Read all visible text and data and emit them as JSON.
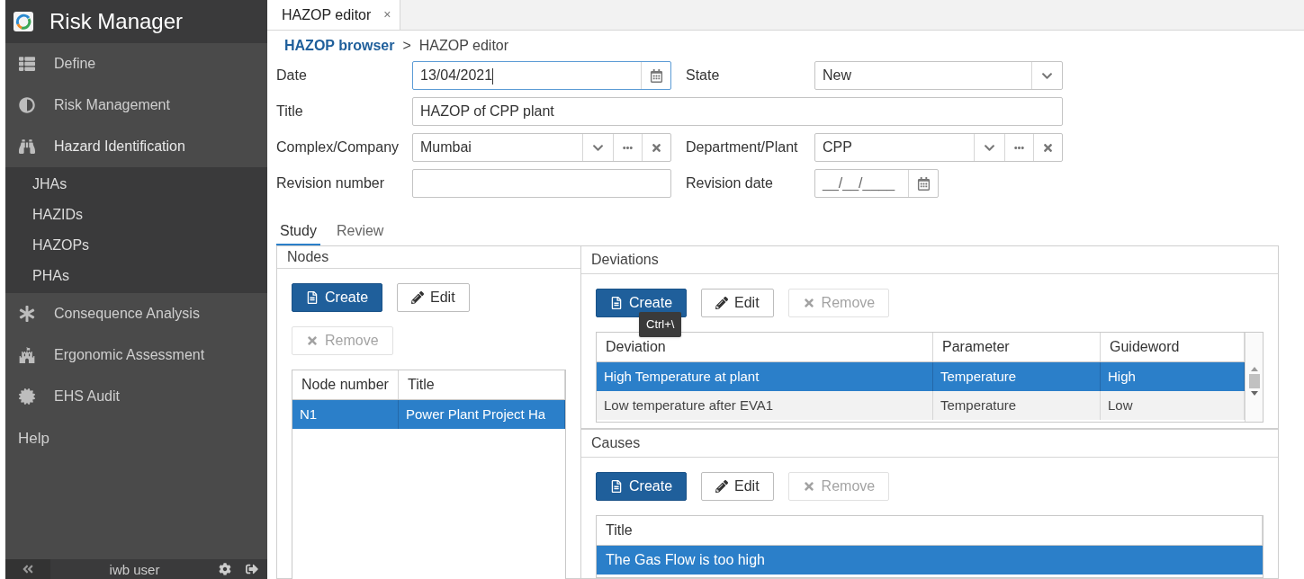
{
  "sidebar": {
    "title": "Risk Manager",
    "items": [
      {
        "label": "Define",
        "expanded": false
      },
      {
        "label": "Risk Management",
        "expanded": false
      },
      {
        "label": "Hazard Identification",
        "expanded": true,
        "children": [
          {
            "label": "JHAs"
          },
          {
            "label": "HAZIDs"
          },
          {
            "label": "HAZOPs"
          },
          {
            "label": "PHAs"
          }
        ]
      },
      {
        "label": "Consequence Analysis",
        "expanded": false
      },
      {
        "label": "Ergonomic Assessment",
        "expanded": false
      },
      {
        "label": "EHS Audit",
        "expanded": false
      }
    ],
    "help": "Help",
    "user": "iwb user"
  },
  "tab": {
    "label": "HAZOP editor",
    "close": "×"
  },
  "breadcrumb": {
    "link": "HAZOP browser",
    "separator": ">",
    "current": "HAZOP editor"
  },
  "form": [
    [
      {
        "label": "Date",
        "kind": "date",
        "value": "13/04/2021",
        "focused": true
      },
      {
        "label": "State",
        "kind": "select",
        "value": "New",
        "focused": false
      }
    ],
    [
      {
        "label": "Title",
        "kind": "text",
        "value": "HAZOP of CPP plant",
        "focused": false
      }
    ],
    [
      {
        "label": "Complex/Company",
        "kind": "lookup",
        "value": "Mumbai",
        "focused": false
      },
      {
        "label": "Department/Plant",
        "kind": "lookup",
        "value": "CPP",
        "focused": false
      }
    ],
    [
      {
        "label": "Revision number",
        "kind": "text",
        "focused": false
      },
      {
        "label": "Revision date",
        "kind": "date",
        "placeholder": "__/__/____",
        "focused": false
      }
    ]
  ],
  "subtabs": [
    {
      "label": "Study",
      "selected": true
    },
    {
      "label": "Review",
      "selected": false
    }
  ],
  "nodes": {
    "title": "Nodes",
    "buttons": [
      {
        "label": "Create",
        "kind": "primary",
        "disabled": false
      },
      {
        "label": "Edit",
        "kind": "edit",
        "disabled": false
      },
      {
        "label": "Remove",
        "kind": "remove",
        "disabled": true
      }
    ],
    "columns": [
      "Node number",
      "Title"
    ],
    "rows": [
      {
        "cells": [
          "N1",
          "Power Plant Project Ha"
        ],
        "selected": true
      }
    ]
  },
  "deviations": {
    "title": "Deviations",
    "buttons": [
      {
        "label": "Create",
        "kind": "primary",
        "disabled": false
      },
      {
        "label": "Edit",
        "kind": "edit",
        "disabled": false
      },
      {
        "label": "Remove",
        "kind": "remove",
        "disabled": true
      }
    ],
    "tooltip": "Ctrl+\\",
    "columns": [
      "Deviation",
      "Parameter",
      "Guideword"
    ],
    "rows": [
      {
        "cells": [
          "High Temperature at plant",
          "Temperature",
          "High"
        ],
        "selected": true
      },
      {
        "cells": [
          "Low temperature after EVA1",
          "Temperature",
          "Low"
        ],
        "selected": false
      }
    ]
  },
  "causes": {
    "title": "Causes",
    "buttons": [
      {
        "label": "Create",
        "kind": "primary",
        "disabled": false
      },
      {
        "label": "Edit",
        "kind": "edit",
        "disabled": false
      },
      {
        "label": "Remove",
        "kind": "remove",
        "disabled": true
      }
    ],
    "columns": [
      "Title"
    ],
    "rows": [
      {
        "cells": [
          "The Gas Flow is too high"
        ],
        "selected": true
      }
    ]
  }
}
